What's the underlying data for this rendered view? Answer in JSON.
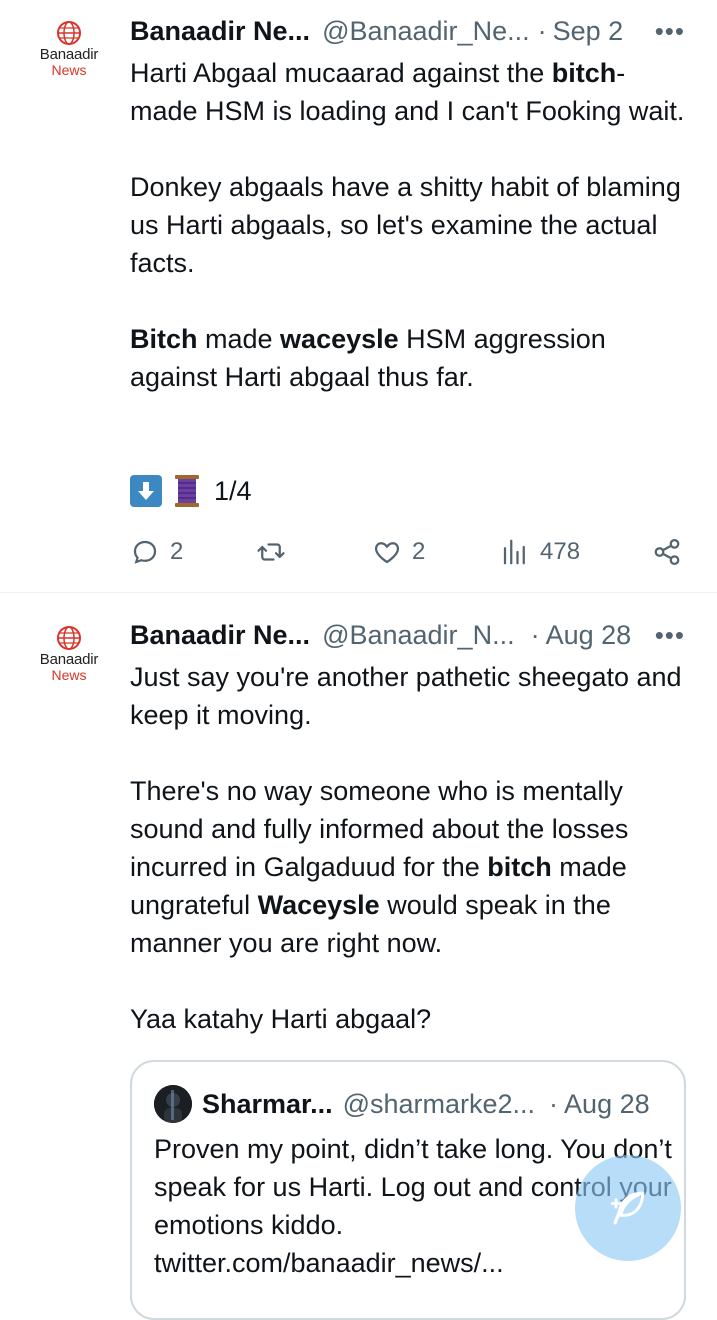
{
  "tweets": [
    {
      "avatar": {
        "brand_line1": "Banaadir",
        "brand_line2": "News"
      },
      "name": "Banaadir Ne...",
      "handle": "@Banaadir_Ne...",
      "dot": "·",
      "date": "Sep 2",
      "more": "•••",
      "para1": {
        "a": "Harti Abgaal mucaarad against the ",
        "b": "bitch",
        "c": "-made HSM is loading and I can't Fooking wait."
      },
      "para2": "Donkey abgaals have a shitty habit of blaming us Harti abgaals, so let's examine the actual facts.",
      "para3": {
        "a": "Bitch",
        "b": " made ",
        "c": "waceysle",
        "d": " HSM aggression against Harti abgaal thus far."
      },
      "thread_counter": "1/4",
      "actions": {
        "replies": "2",
        "likes": "2",
        "views": "478"
      }
    },
    {
      "avatar": {
        "brand_line1": "Banaadir",
        "brand_line2": "News"
      },
      "name": "Banaadir Ne...",
      "handle": "@Banaadir_N...",
      "dot": "·",
      "date": "Aug 28",
      "more": "•••",
      "para1": "Just say you're another pathetic sheegato and keep it moving.",
      "para2": {
        "a": "There's no way someone who is mentally sound and fully informed about the losses incurred in Galgaduud for the ",
        "b": "bitch",
        "c": " made ungrateful ",
        "d": "Waceysle",
        "e": " would speak in the manner you are right now."
      },
      "para3": "Yaa katahy Harti abgaal?",
      "quote": {
        "name": "Sharmar...",
        "handle": "@sharmarke2...",
        "dot": "·",
        "date": "Aug 28",
        "text": "Proven my point, didn’t take long. You don’t speak for us Harti. Log out and control your emotions kiddo. twitter.com/banaadir_news/..."
      }
    }
  ],
  "colors": {
    "accent": "#1d9bf0",
    "muted": "#536471",
    "brand_red": "#d9342b",
    "fab": "#8cc8f5"
  }
}
